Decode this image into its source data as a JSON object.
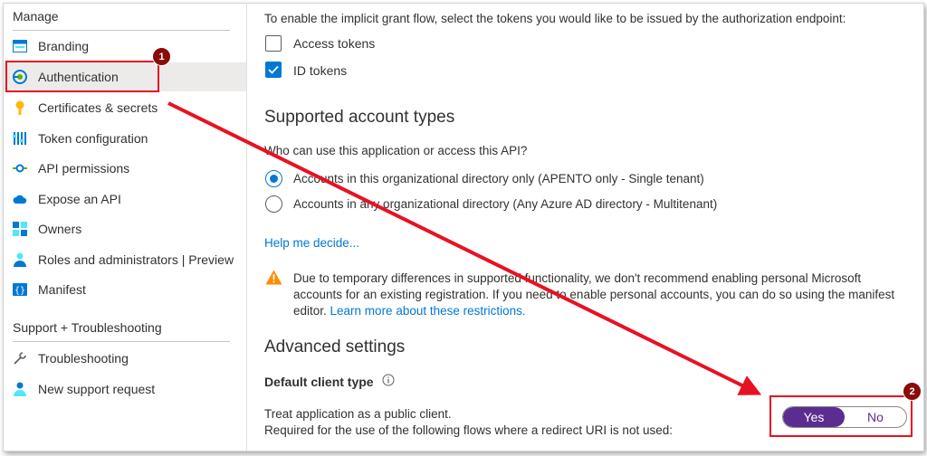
{
  "sidebar": {
    "manage_heading": "Manage",
    "items": [
      {
        "label": "Branding",
        "icon": "branding-icon"
      },
      {
        "label": "Authentication",
        "icon": "authentication-icon",
        "selected": true
      },
      {
        "label": "Certificates & secrets",
        "icon": "key-icon"
      },
      {
        "label": "Token configuration",
        "icon": "token-icon"
      },
      {
        "label": "API permissions",
        "icon": "api-permissions-icon"
      },
      {
        "label": "Expose an API",
        "icon": "cloud-icon"
      },
      {
        "label": "Owners",
        "icon": "owners-icon"
      },
      {
        "label": "Roles and administrators | Preview",
        "icon": "roles-icon"
      },
      {
        "label": "Manifest",
        "icon": "manifest-icon"
      }
    ],
    "support_heading": "Support + Troubleshooting",
    "support_items": [
      {
        "label": "Troubleshooting",
        "icon": "wrench-icon"
      },
      {
        "label": "New support request",
        "icon": "person-icon"
      }
    ]
  },
  "main": {
    "implicit_text": "To enable the implicit grant flow, select the tokens you would like to be issued by the authorization endpoint:",
    "access_tokens": {
      "label": "Access tokens",
      "checked": false
    },
    "id_tokens": {
      "label": "ID tokens",
      "checked": true
    },
    "supported_heading": "Supported account types",
    "who_text": "Who can use this application or access this API?",
    "radio_single": {
      "label": "Accounts in this organizational directory only (APENTO only - Single tenant)",
      "selected": true
    },
    "radio_multi": {
      "label": "Accounts in any organizational directory (Any Azure AD directory - Multitenant)",
      "selected": false
    },
    "help_link": "Help me decide...",
    "warning_line1": "Due to temporary differences in supported functionality, we don't recommend enabling personal Microsoft",
    "warning_line2": "accounts for an existing registration. If you need to enable personal accounts, you can do so using the manifest",
    "warning_line3_prefix": "editor. ",
    "warning_link": "Learn more about these restrictions.",
    "advanced_heading": "Advanced settings",
    "default_client_label": "Default client type",
    "treat_text": "Treat application as a public client.",
    "required_text": "Required for the use of the following flows where a redirect URI is not used:",
    "toggle": {
      "yes": "Yes",
      "no": "No",
      "selected": "Yes"
    }
  },
  "annotations": {
    "badge1": "1",
    "badge2": "2",
    "color": "#e81123"
  }
}
